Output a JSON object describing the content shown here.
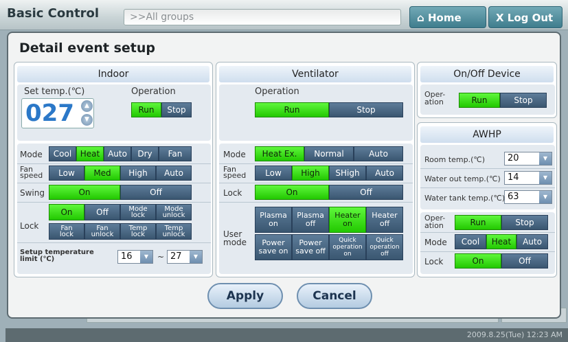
{
  "header": {
    "title": "Basic Control",
    "group_field": ">>All groups",
    "home_label": "Home",
    "logout_label": "X Log Out"
  },
  "status": {
    "datetime": "2009.8.25(Tue)  12:23 AM"
  },
  "dialog": {
    "title": "Detail event setup",
    "apply_label": "Apply",
    "cancel_label": "Cancel",
    "indoor": {
      "title": "Indoor",
      "set_temp_label": "Set temp.(℃)",
      "set_temp_value": "027",
      "operation_label": "Operation",
      "run": "Run",
      "stop": "Stop",
      "operation_selected": "Run",
      "mode_label": "Mode",
      "modes": [
        "Cool",
        "Heat",
        "Auto",
        "Dry",
        "Fan"
      ],
      "mode_selected": "Heat",
      "fan_label_1": "Fan",
      "fan_label_2": "speed",
      "fan": [
        "Low",
        "Med",
        "High",
        "Auto"
      ],
      "fan_selected": "Med",
      "swing_label": "Swing",
      "on": "On",
      "off": "Off",
      "swing_selected": "On",
      "lock_label": "Lock",
      "lock_selected": "On",
      "lock_row1": [
        [
          "Mode",
          "lock"
        ],
        [
          "Mode",
          "unlock"
        ]
      ],
      "lock_row2": [
        [
          "Fan",
          "lock"
        ],
        [
          "Fan",
          "unlock"
        ],
        [
          "Temp",
          "lock"
        ],
        [
          "Temp",
          "unlock"
        ]
      ],
      "limit_label_1": "Setup temperature",
      "limit_label_2": "limit (℃)",
      "limit_low": "16",
      "limit_sep": "~",
      "limit_high": "27"
    },
    "ventilator": {
      "title": "Ventilator",
      "operation_label": "Operation",
      "run": "Run",
      "stop": "Stop",
      "operation_selected": "Run",
      "mode_label": "Mode",
      "modes": [
        "Heat Ex.",
        "Normal",
        "Auto"
      ],
      "mode_selected": "Heat Ex.",
      "fan_label_1": "Fan",
      "fan_label_2": "speed",
      "fan": [
        "Low",
        "High",
        "SHigh",
        "Auto"
      ],
      "fan_selected": "High",
      "lock_label": "Lock",
      "on": "On",
      "off": "Off",
      "lock_selected": "On",
      "user_label_1": "User",
      "user_label_2": "mode",
      "user_row1": [
        [
          "Plasma",
          "on"
        ],
        [
          "Plasma",
          "off"
        ],
        [
          "Heater",
          "on"
        ],
        [
          "Heater",
          "off"
        ]
      ],
      "user_row1_selected": 2,
      "user_row2": [
        [
          "Power",
          "save on"
        ],
        [
          "Power",
          "save off"
        ],
        [
          "Quick",
          "operation",
          "on"
        ],
        [
          "Quick",
          "operation",
          "off"
        ]
      ]
    },
    "onoff": {
      "title": "On/Off Device",
      "oper_label_1": "Oper-",
      "oper_label_2": "ation",
      "run": "Run",
      "stop": "Stop",
      "selected": "Run"
    },
    "awhp": {
      "title": "AWHP",
      "room_label": "Room temp.(℃)",
      "room_value": "20",
      "water_out_label": "Water out temp.(℃)",
      "water_out_value": "14",
      "tank_label": "Water tank temp.(℃)",
      "tank_value": "63",
      "oper_label_1": "Oper-",
      "oper_label_2": "ation",
      "run": "Run",
      "stop": "Stop",
      "oper_selected": "Run",
      "mode_label": "Mode",
      "modes": [
        "Cool",
        "Heat",
        "Auto"
      ],
      "mode_selected": "Heat",
      "lock_label": "Lock",
      "on": "On",
      "off": "Off",
      "lock_selected": "On"
    }
  },
  "colors": {
    "selected": "#33dd11",
    "button": "#4a6884",
    "header_btn": "#4f8fa0"
  }
}
